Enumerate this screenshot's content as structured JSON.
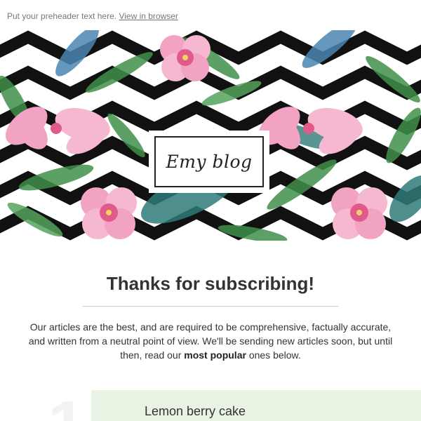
{
  "preheader": {
    "text": "Put your preheader text here.",
    "link": "View in browser"
  },
  "hero": {
    "logo_text": "Emy blog"
  },
  "content": {
    "title": "Thanks for subscribing!",
    "intro_part1": "Our articles are the best, and are required to be comprehensive, factually accurate, and written from a neutral point of view. We'll be sending new articles soon, but until then, read our ",
    "intro_bold": "most popular",
    "intro_part2": " ones below."
  },
  "articles": [
    {
      "number": "1",
      "title": "Lemon berry cake"
    }
  ],
  "colors": {
    "zigzag": "#111111",
    "leaf_green": "#3f8f4a",
    "leaf_teal": "#2f7a78",
    "leaf_blue": "#4a86b0",
    "flower_pink": "#f2a3c3",
    "flower_magenta": "#e05a8a",
    "article_bg": "#e8f3e4"
  }
}
